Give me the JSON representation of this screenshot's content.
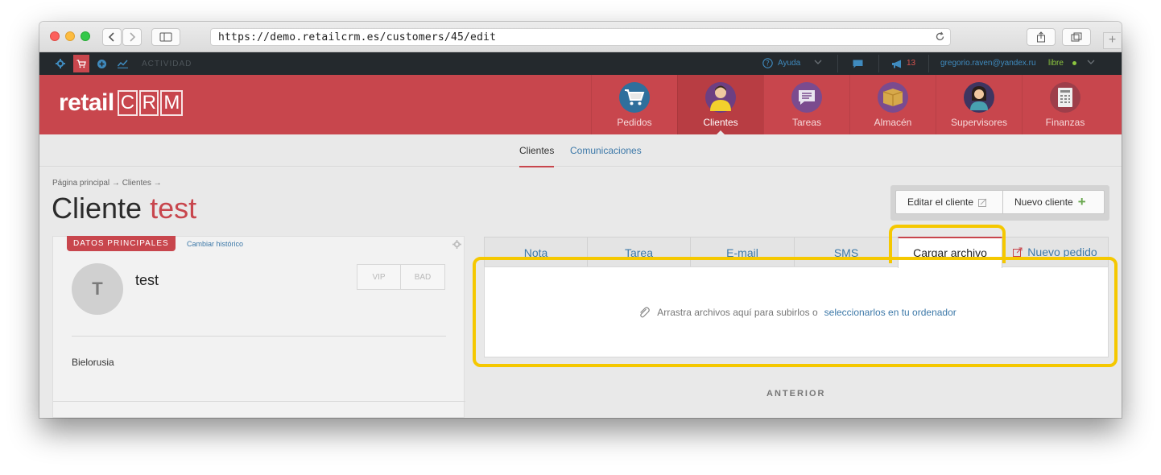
{
  "browser": {
    "url": "https://demo.retailcrm.es/customers/45/edit"
  },
  "topbar": {
    "activity_label": "ACTIVIDAD",
    "help_label": "Ayuda",
    "notifications_count": "13",
    "user_email": "gregorio.raven@yandex.ru",
    "user_status": "libre"
  },
  "header": {
    "logo_text": "retail",
    "logo_crm": [
      "C",
      "R",
      "M"
    ],
    "nav": [
      {
        "label": "Pedidos",
        "icon": "cart-icon",
        "color": "#3f8bbf"
      },
      {
        "label": "Clientes",
        "icon": "person-icon",
        "color": "#7a4a8c"
      },
      {
        "label": "Tareas",
        "icon": "task-list-icon",
        "color": "#7b4b8e"
      },
      {
        "label": "Almacén",
        "icon": "box-icon",
        "color": "#8e6a3e"
      },
      {
        "label": "Supervisores",
        "icon": "supervisor-icon",
        "color": "#3a3a6a"
      },
      {
        "label": "Finanzas",
        "icon": "finance-icon",
        "color": "#9e3e4a"
      }
    ]
  },
  "subnav": {
    "tab_clientes": "Clientes",
    "tab_comunicaciones": "Comunicaciones"
  },
  "page": {
    "breadcrumb": "Página principal → Clientes →",
    "title_prefix": "Cliente",
    "title_name": "test",
    "edit_button": "Editar el cliente",
    "new_client_button": "Nuevo cliente"
  },
  "card": {
    "badge": "DATOS PRINCIPALES",
    "history_link": "Cambiar histórico",
    "avatar_initial": "T",
    "name": "test",
    "tag_vip": "VIP",
    "tag_bad": "BAD",
    "country": "Bielorusia"
  },
  "tabs": {
    "nota": "Nota",
    "tarea": "Tarea",
    "email": "E-mail",
    "sms": "SMS",
    "cargar": "Cargar archivo",
    "nuevo_pedido": "Nuevo pedido"
  },
  "dropzone": {
    "text": "Arrastra archivos aquí para subirlos o",
    "link": "seleccionarlos en tu ordenador"
  },
  "footer": {
    "anterior": "ANTERIOR"
  },
  "colors": {
    "brand_red": "#c8464d",
    "link_blue": "#3c78a8",
    "highlight": "#f5c800"
  }
}
